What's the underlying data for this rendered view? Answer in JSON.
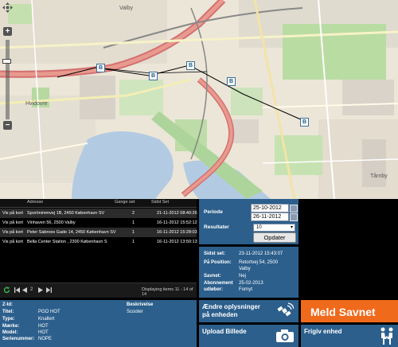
{
  "map": {
    "places": {
      "valby": "Valby",
      "hvidovre": "Hvidovre",
      "tarnby": "Tårnby"
    },
    "zoom_plus": "+",
    "zoom_minus": "−",
    "markers": [
      "B",
      "B",
      "B",
      "B",
      "B"
    ]
  },
  "table": {
    "headers": {
      "adresse": "Adresse",
      "gange": "Gange set",
      "sidst": "Sidst Set"
    },
    "rows": [
      {
        "link": "Vis på kort",
        "adresse": "Sporönimmvej 1B, 2450 København SV",
        "gange": "2",
        "sidst": "21-11-2012 08:40:26"
      },
      {
        "link": "Vis på kort",
        "adresse": "Vinhaven 56, 2500 Valby",
        "gange": "1",
        "sidst": "16-11-2012 15:52:12"
      },
      {
        "link": "Vis på kort",
        "adresse": "Peter Sabroes Gade 14, 2450 København SV",
        "gange": "1",
        "sidst": "16-11-2012 15:28:03"
      },
      {
        "link": "Vis på kort",
        "adresse": "Bella Center Station , 2300 København S",
        "gange": "1",
        "sidst": "16-11-2012 13:50:13"
      }
    ],
    "pager": {
      "page": "2",
      "display": "Displaying items 11 - 14 of 14"
    }
  },
  "filter": {
    "periode_label": "Periode",
    "date_from": "25-10-2012",
    "date_to": "26-11-2012",
    "resultater_label": "Resultater",
    "resultater_value": "10",
    "opdater_label": "Opdater"
  },
  "status": {
    "sidst_set_label": "Sidst set:",
    "sidst_set_value": "23-11-2012 15:43:07",
    "position_label": "På Position:",
    "position_value_1": "Retortvej 54, 2500",
    "position_value_2": "Valby",
    "savnet_label": "Savnet:",
    "savnet_value": "Nej",
    "abonnement_label_1": "Abonnement",
    "abonnement_label_2": "udløber:",
    "abonnement_value_1": "25-02-2013",
    "abonnement_value_2": "Fornyt"
  },
  "details": {
    "zid_label": "Z-Id:",
    "zid_value": "",
    "titel_label": "Titel:",
    "titel_value": "PGO HOT",
    "type_label": "Type:",
    "type_value": "Knallert",
    "maerke_label": "Mærke:",
    "maerke_value": "HOT",
    "model_label": "Model:",
    "model_value": "HOT",
    "serie_label": "Serienummer:",
    "serie_value": "NOPE",
    "beskrivelse_label": "Beskrivelse",
    "beskrivelse_value": "Scooter"
  },
  "actions": {
    "aendre_line1": "Ændre oplysninger",
    "aendre_line2": "på enheden",
    "meld_savnet": "Meld Savnet",
    "upload_billede": "Upload Billede",
    "frigiv_enhed": "Frigiv enhed"
  },
  "colors": {
    "panel_blue": "#2c5f8c",
    "meld_orange": "#f06a1c"
  }
}
